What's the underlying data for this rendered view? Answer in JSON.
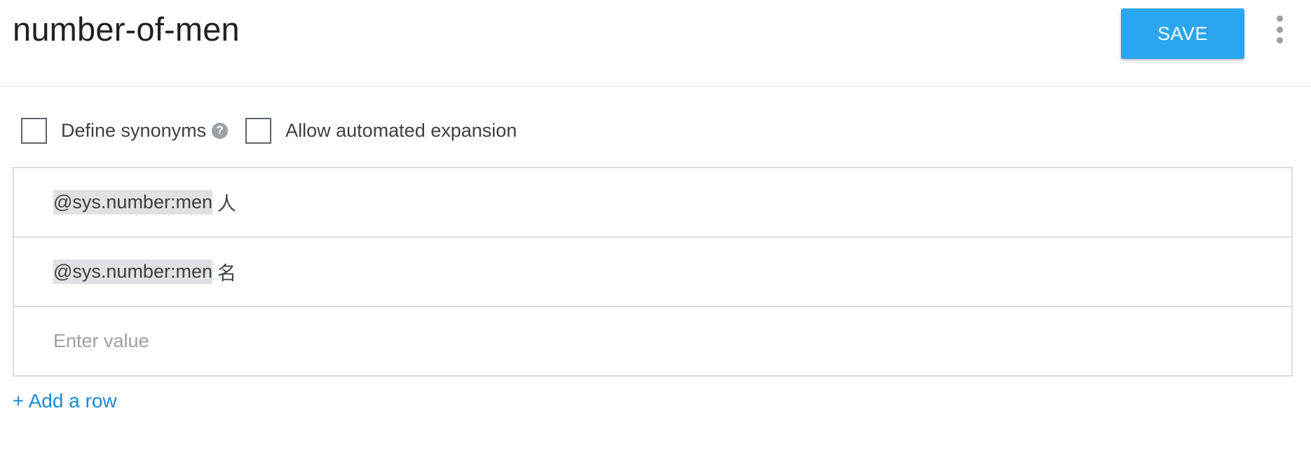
{
  "header": {
    "title": "number-of-men",
    "save_label": "SAVE"
  },
  "options": {
    "define_synonyms": {
      "label": "Define synonyms",
      "checked": false
    },
    "help_icon": "question-circle",
    "allow_expansion": {
      "label": "Allow automated expansion",
      "checked": false
    }
  },
  "rows": [
    {
      "entity": "@sys.number:men",
      "suffix": "人"
    },
    {
      "entity": "@sys.number:men",
      "suffix": "名"
    }
  ],
  "new_row": {
    "placeholder": "Enter value"
  },
  "add_row_label": "+ Add a row",
  "colors": {
    "accent": "#2aa5ef",
    "link": "#1e88d3",
    "chip": "#dfe1e5"
  }
}
